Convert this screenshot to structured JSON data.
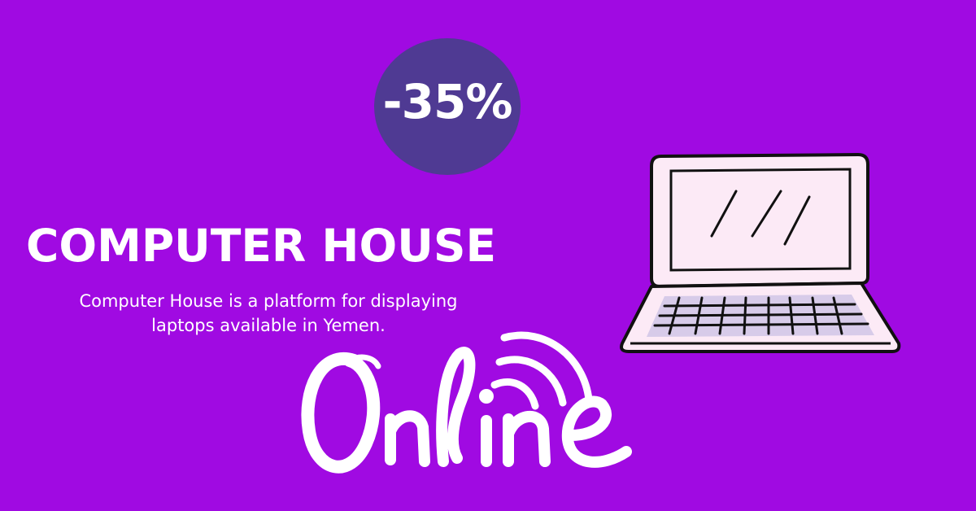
{
  "badge": {
    "text": "-35%"
  },
  "brand": {
    "title": "COMPUTER HOUSE",
    "description_line1": "Computer House is a platform for displaying",
    "description_line2": "laptops available in Yemen."
  },
  "online_logo": {
    "text": "Online",
    "icons": [
      "wifi-signal-icon"
    ]
  },
  "illustration": {
    "icon": "laptop-icon"
  },
  "colors": {
    "background": "#a00ae2",
    "badge": "#4f3a93",
    "text": "#ffffff",
    "laptop_screen": "#fceaf6",
    "laptop_keyboard_deck": "#d7cbe9"
  }
}
